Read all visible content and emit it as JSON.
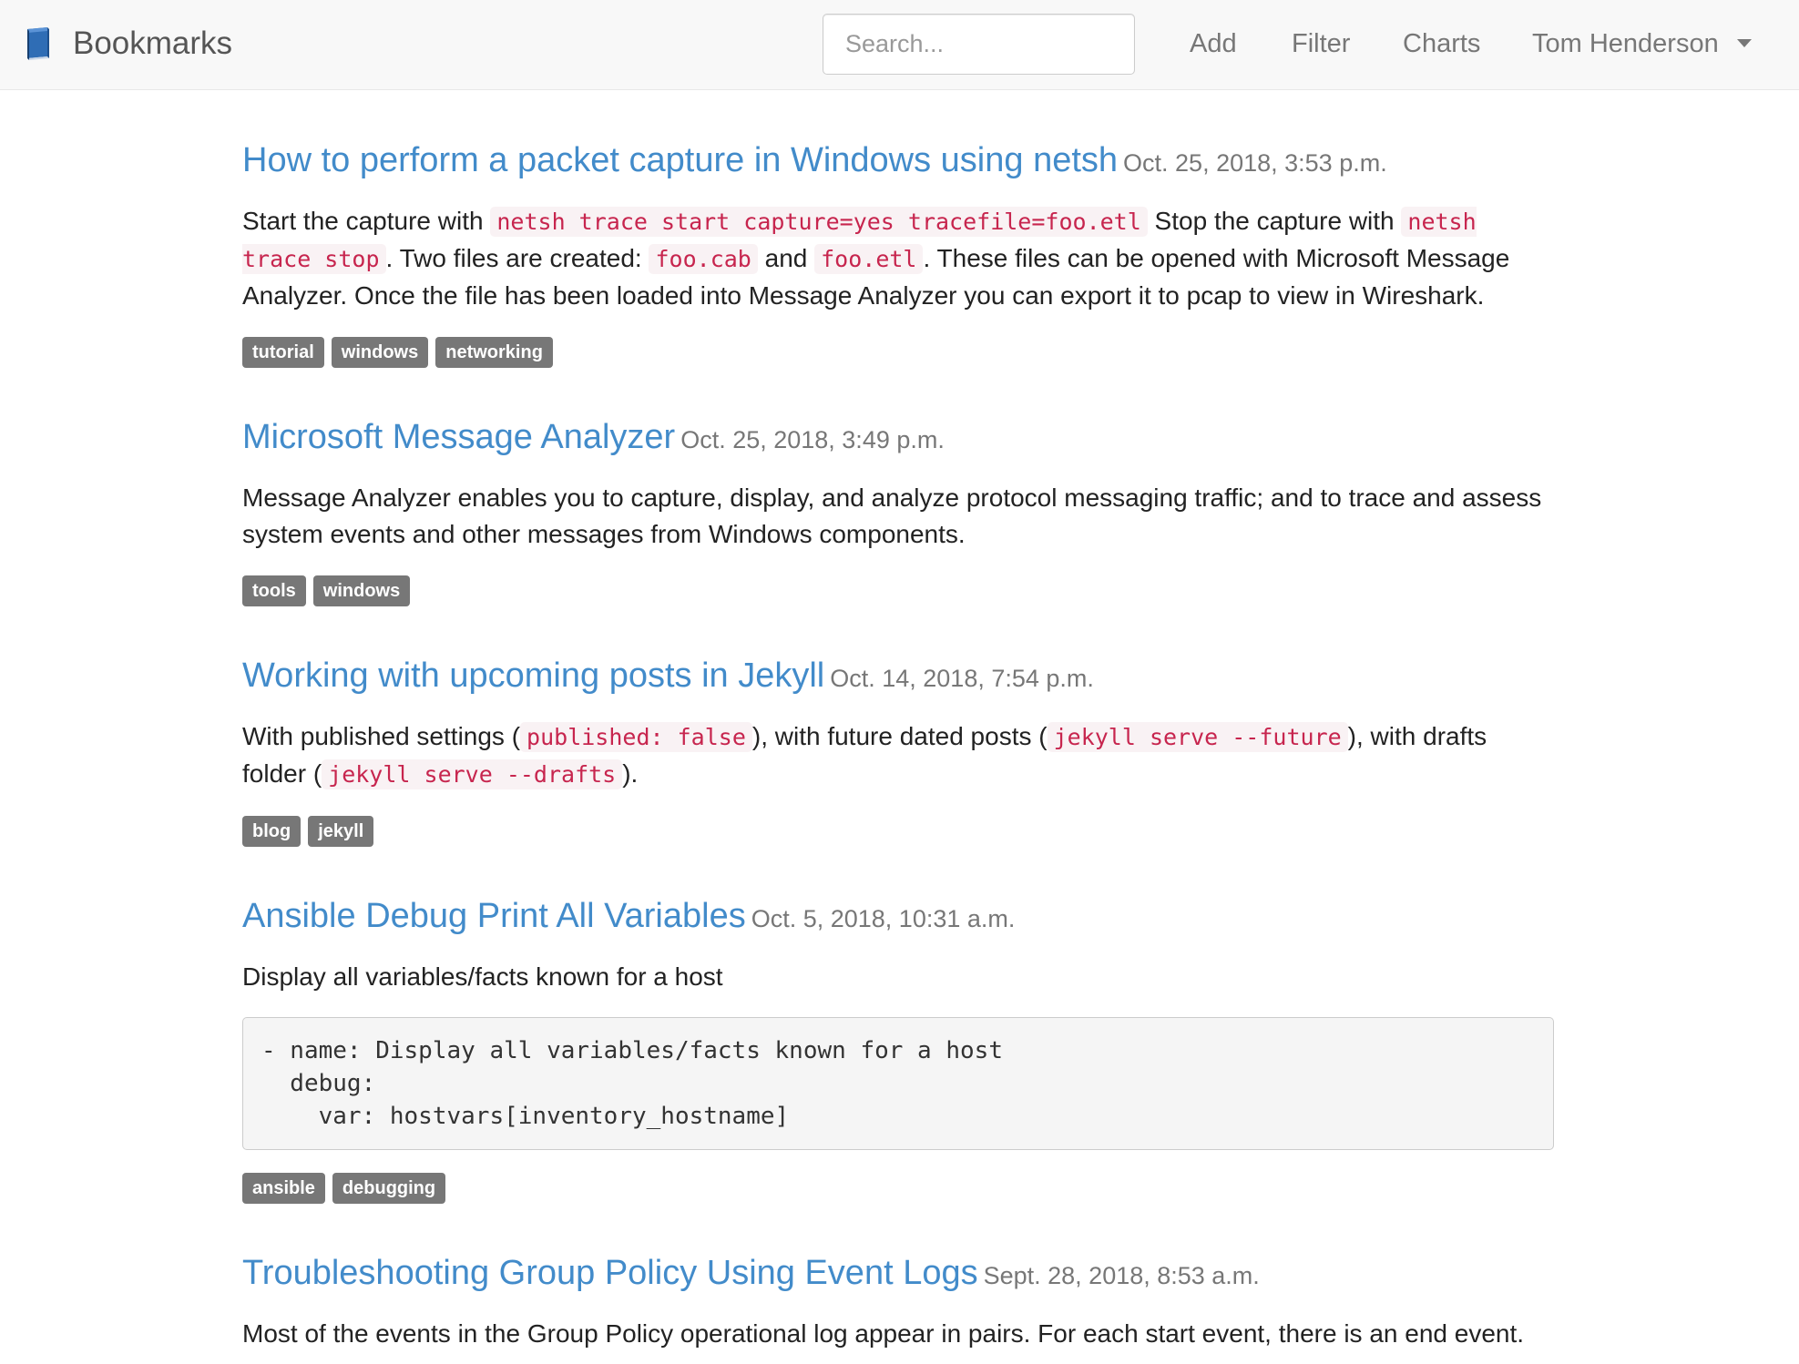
{
  "navbar": {
    "brand": "Bookmarks",
    "search_placeholder": "Search...",
    "links": {
      "add": "Add",
      "filter": "Filter",
      "charts": "Charts",
      "user": "Tom Henderson"
    }
  },
  "colors": {
    "link": "#428bca",
    "tag_bg": "#777777",
    "code_text": "#c7254e",
    "code_bg": "#f9f2f4"
  },
  "bookmarks": [
    {
      "title": "How to perform a packet capture in Windows using netsh",
      "date": "Oct. 25, 2018, 3:53 p.m.",
      "desc": [
        {
          "t": "Start the capture with "
        },
        {
          "c": "netsh trace start capture=yes tracefile=foo.etl"
        },
        {
          "t": " Stop the capture with "
        },
        {
          "c": "netsh trace stop"
        },
        {
          "t": ". Two files are created: "
        },
        {
          "c": "foo.cab"
        },
        {
          "t": " and "
        },
        {
          "c": "foo.etl"
        },
        {
          "t": ". These files can be opened with Microsoft Message Analyzer. Once the file has been loaded into Message Analyzer you can export it to pcap to view in Wireshark."
        }
      ],
      "tags": [
        "tutorial",
        "windows",
        "networking"
      ]
    },
    {
      "title": "Microsoft Message Analyzer",
      "date": "Oct. 25, 2018, 3:49 p.m.",
      "desc": [
        {
          "t": "Message Analyzer enables you to capture, display, and analyze protocol messaging traffic; and to trace and assess system events and other messages from Windows components."
        }
      ],
      "tags": [
        "tools",
        "windows"
      ]
    },
    {
      "title": "Working with upcoming posts in Jekyll",
      "date": "Oct. 14, 2018, 7:54 p.m.",
      "desc": [
        {
          "t": "With published settings ("
        },
        {
          "c": "published: false"
        },
        {
          "t": "), with future dated posts ("
        },
        {
          "c": "jekyll serve --future"
        },
        {
          "t": "), with drafts folder ("
        },
        {
          "c": "jekyll serve --drafts"
        },
        {
          "t": ")."
        }
      ],
      "tags": [
        "blog",
        "jekyll"
      ]
    },
    {
      "title": "Ansible Debug Print All Variables",
      "date": "Oct. 5, 2018, 10:31 a.m.",
      "desc": [
        {
          "t": "Display all variables/facts known for a host"
        }
      ],
      "code_block": "- name: Display all variables/facts known for a host\n  debug:\n    var: hostvars[inventory_hostname]",
      "tags": [
        "ansible",
        "debugging"
      ]
    },
    {
      "title": "Troubleshooting Group Policy Using Event Logs",
      "date": "Sept. 28, 2018, 8:53 a.m.",
      "desc": [
        {
          "t": "Most of the events in the Group Policy operational log appear in pairs. For each start event, there is an end event."
        }
      ],
      "tags": []
    }
  ]
}
